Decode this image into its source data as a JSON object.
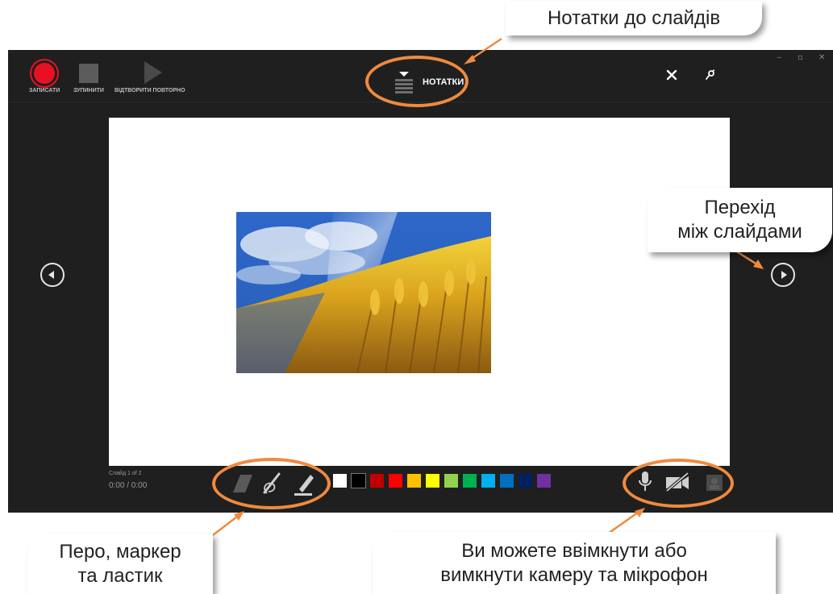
{
  "callouts": {
    "notes": "Нотатки до слайдів",
    "nav_line1": "Перехід",
    "nav_line2": "між слайдами",
    "pen_line1": "Перо, маркер",
    "pen_line2": "та ластик",
    "media_line1": "Ви можете ввімкнути або",
    "media_line2": "вимкнути камеру та мікрофон"
  },
  "toolbar": {
    "record_label": "ЗАПИСАТИ",
    "stop_label": "ЗУПИНИТИ",
    "replay_label": "ВІДТВОРИТИ ПОВТОРНО",
    "notes_label": "НОТАТКИ"
  },
  "status": {
    "slide_counter": "Слайд 1 of 2",
    "time": "0:00 / 0:00"
  },
  "icons": {
    "record": "record-icon",
    "stop": "stop-icon",
    "replay": "play-icon",
    "notes": "notes-icon",
    "close": "close-icon",
    "pin": "pin-icon",
    "prev": "previous-slide-icon",
    "next": "next-slide-icon",
    "eraser": "eraser-icon",
    "pen": "pen-icon",
    "highlighter": "highlighter-icon",
    "microphone": "microphone-icon",
    "camera_off": "camera-off-icon",
    "camera_preview": "camera-preview-icon"
  },
  "ink_colors": [
    "#ffffff",
    "#000000",
    "#c00000",
    "#ff0000",
    "#ffc000",
    "#ffff00",
    "#92d050",
    "#00b050",
    "#00b0f0",
    "#0070c0",
    "#002060",
    "#7030a0"
  ],
  "colors": {
    "accent": "#f08a3e",
    "record": "#e81123",
    "screen_bg": "#1f1f1f"
  }
}
